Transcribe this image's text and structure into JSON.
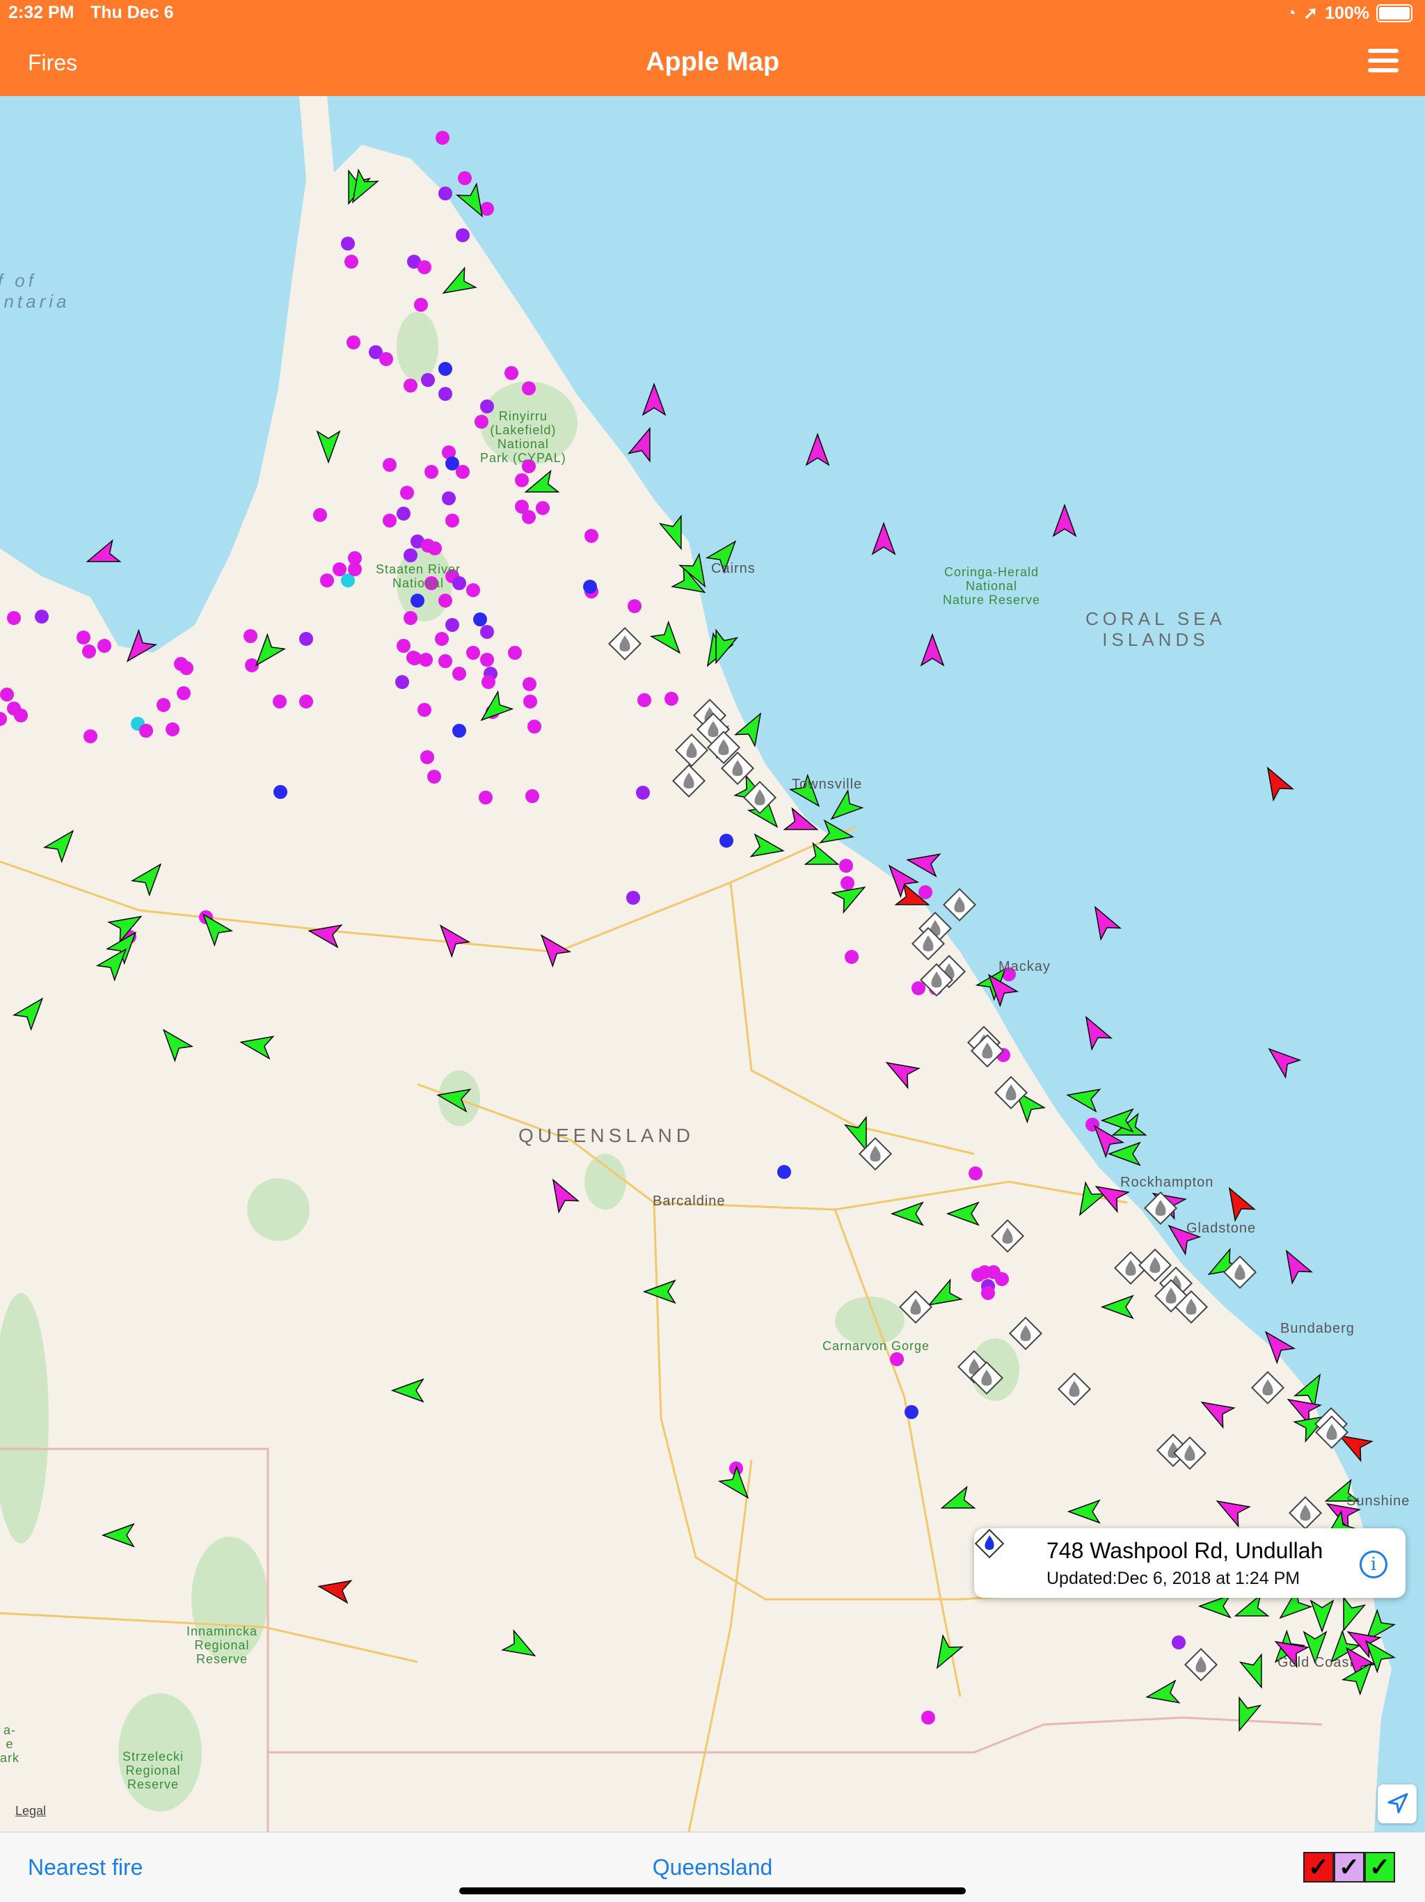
{
  "status": {
    "time": "2:32 PM",
    "date": "Thu Dec 6",
    "battery": "100%"
  },
  "nav": {
    "back_label": "Fires",
    "title": "Apple Map"
  },
  "map": {
    "labels": {
      "gulf": "lf of\nentaria",
      "cairns": "Cairns",
      "townsville": "Townsville",
      "mackay": "Mackay",
      "queensland": "QUEENSLAND",
      "barcaldine": "Barcaldine",
      "rockhampton": "Rockhampton",
      "gladstone": "Gladstone",
      "bundaberg": "Bundaberg",
      "sunshine": "Sunshine",
      "gold_coast": "Gold Coast",
      "coral_sea": "CORAL SEA\nISLANDS",
      "rinyirru": "Rinyirru\n(Lakefield)\nNational\nPark (CYPAL)",
      "staaten": "Staaten River\nNational",
      "coringa": "Coringa-Herald\nNational\nNature Reserve",
      "carnarvon": "Carnarvon Gorge",
      "innamincka": "Innamincka\nRegional\nReserve",
      "strzelecki": "Strzelecki\nRegional\nReserve",
      "park_fragment": "a-\ne\nark"
    },
    "legal": "Legal",
    "colors": {
      "land": "#f5f1e8",
      "water": "#aadff2",
      "park": "#cfe6c4",
      "road": "#f2c86b",
      "fire_magenta": "#e11ce8",
      "fire_purple": "#9a22f0",
      "fire_blue": "#2a2aee",
      "arrow_green": "#22ee22",
      "arrow_magenta": "#ee22dd",
      "arrow_red": "#ee1111"
    }
  },
  "callout": {
    "title": "748 Washpool Rd, Undullah",
    "subtitle": "Updated:Dec 6, 2018 at 1:24 PM",
    "info_icon": "info-icon",
    "icon": "fire-warning-icon"
  },
  "toolbar": {
    "nearest_fire": "Nearest fire",
    "region": "Queensland",
    "filters": [
      {
        "name": "filter-red",
        "color": "#ee1111",
        "checked": true
      },
      {
        "name": "filter-lilac",
        "color": "#d9a8f0",
        "checked": true
      },
      {
        "name": "filter-green",
        "color": "#22ee22",
        "checked": true
      }
    ]
  }
}
